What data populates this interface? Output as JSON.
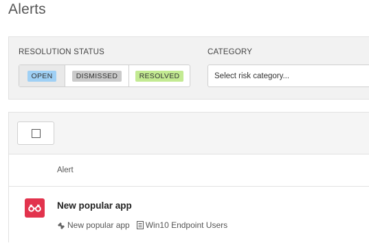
{
  "page": {
    "title": "Alerts"
  },
  "filters": {
    "resolution_status_label": "RESOLUTION STATUS",
    "status_options": [
      {
        "label": "OPEN",
        "color": "#9fd0f5",
        "selected": true
      },
      {
        "label": "DISMISSED",
        "color": "#cacaca",
        "selected": false
      },
      {
        "label": "RESOLVED",
        "color": "#c3ea92",
        "selected": false
      }
    ],
    "category_label": "CATEGORY",
    "category_placeholder": "Select risk category..."
  },
  "table": {
    "select_all_checked": false,
    "column_header": "Alert",
    "rows": [
      {
        "icon": "binoculars-icon",
        "icon_color": "#e2334d",
        "title": "New popular app",
        "meta": [
          {
            "icon": "app-puzzle-icon",
            "text": "New popular app"
          },
          {
            "icon": "document-list-icon",
            "text": "Win10 Endpoint Users"
          }
        ]
      }
    ]
  }
}
